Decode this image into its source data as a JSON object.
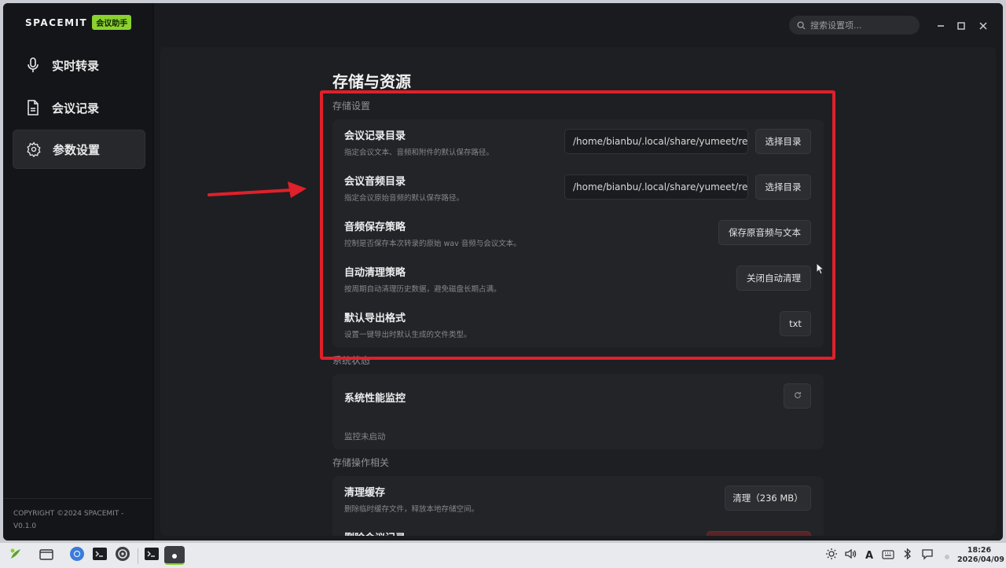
{
  "app": {
    "brand_logo": "SPACEMIT",
    "brand_badge": "会议助手",
    "search_placeholder": "搜索设置项...",
    "copyright": "COPYRIGHT ©2024 SPACEMIT - V0.1.0"
  },
  "sidebar": {
    "items": [
      {
        "label": "实时转录",
        "icon": "microphone-icon",
        "active": false
      },
      {
        "label": "会议记录",
        "icon": "document-icon",
        "active": false
      },
      {
        "label": "参数设置",
        "icon": "gear-icon",
        "active": true
      }
    ]
  },
  "page": {
    "title": "存储与资源",
    "storage_section": {
      "label": "存储设置",
      "rows": [
        {
          "title": "会议记录目录",
          "desc": "指定会议文本、音频和附件的默认保存路径。",
          "value": "/home/bianbu/.local/share/yumeet/reco",
          "button": "选择目录"
        },
        {
          "title": "会议音频目录",
          "desc": "指定会议原始音频的默认保存路径。",
          "value": "/home/bianbu/.local/share/yumeet/reco",
          "button": "选择目录"
        },
        {
          "title": "音频保存策略",
          "desc": "控制是否保存本次转录的原始 wav 音频与会议文本。",
          "button": "保存原音频与文本"
        },
        {
          "title": "自动清理策略",
          "desc": "按周期自动清理历史数据，避免磁盘长期占满。",
          "button": "关闭自动清理"
        },
        {
          "title": "默认导出格式",
          "desc": "设置一键导出时默认生成的文件类型。",
          "button": "txt"
        }
      ]
    },
    "system_section": {
      "label": "系统状态",
      "monitor_title": "系统性能监控",
      "monitor_status": "监控未启动"
    },
    "ops_section": {
      "label": "存储操作相关",
      "clear_cache_title": "清理缓存",
      "clear_cache_desc": "删除临时缓存文件，释放本地存储空间。",
      "clear_cache_button": "清理（236 MB）",
      "delete_records_title": "删除会议记录"
    }
  },
  "taskbar": {
    "time": "18:26",
    "date": "2026/04/09",
    "input_method": "A"
  },
  "colors": {
    "accent_green": "#8ad22d",
    "highlight_red": "#e0202a",
    "danger": "#5a2326"
  }
}
